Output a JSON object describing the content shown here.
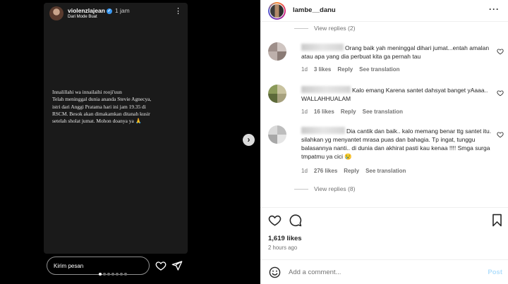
{
  "story": {
    "username": "violenzlajean",
    "time": "1 jam",
    "subtitle": "Dari Mode Buat",
    "text_lines": [
      "Innalillahi wa innailaihi rooji'uun",
      "Telah meninggal dunia ananda Stevie Agnecya,",
      "istri dari Anggi Pratama hari ini jam 19.35 di",
      "RSCM.  Besok akan dimakamkan ditanah kusir",
      "setelah sholat jumat. Mohon doanya ya 🙏"
    ],
    "reply_placeholder": "Kirim pesan",
    "icons": [
      "heart-icon",
      "send-icon",
      "more-icon",
      "verified-icon",
      "chevron-right-icon"
    ]
  },
  "post": {
    "username": "lambe__danu",
    "view_replies_top": "View replies (2)",
    "comments": [
      {
        "text": "Orang baik yah meninggal dihari jumat...entah amalan atau apa yang dia perbuat kita ga pernah tau",
        "time": "1d",
        "likes": "3 likes",
        "reply": "Reply",
        "translate": "See translation"
      },
      {
        "text": "Kalo emang Karena santet dahsyat banget yAaaa.. WALLAHHUALAM",
        "time": "1d",
        "likes": "16 likes",
        "reply": "Reply",
        "translate": "See translation"
      },
      {
        "text": "Dia cantik dan baik.. kalo memang benar ttg santet itu. silahkan yg menyantet mrasa puas dan bahagia. Tp ingat, tunggu balasannya nanti.. di dunia dan akhirat pasti kau kenaa !!!! Smga surga tmpatmu ya cici 😢",
        "time": "1d",
        "likes": "276 likes",
        "reply": "Reply",
        "translate": "See translation"
      }
    ],
    "view_replies_bottom": "View replies (8)",
    "likes_count": "1,619 likes",
    "posted_ago": "2 hours ago",
    "add_comment_placeholder": "Add a comment...",
    "post_button": "Post",
    "accent_color": "#0095f6"
  }
}
